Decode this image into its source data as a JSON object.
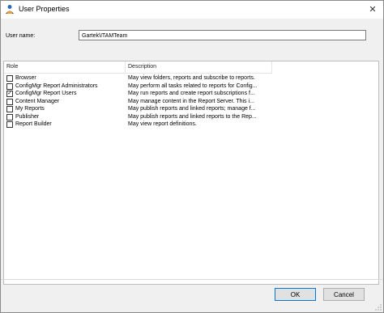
{
  "window": {
    "title": "User Properties"
  },
  "form": {
    "username_label": "User name:",
    "username_value": "Gartek\\ITAMTeam"
  },
  "grid": {
    "columns": [
      "Role",
      "Description"
    ],
    "rows": [
      {
        "role": "Browser",
        "description": "May view folders, reports and subscribe to reports.",
        "checked": false
      },
      {
        "role": "ConfigMgr Report Administrators",
        "description": "May perform all tasks related to reports for Config...",
        "checked": false
      },
      {
        "role": "ConfigMgr Report Users",
        "description": "May run reports and create report subscriptions f...",
        "checked": true
      },
      {
        "role": "Content Manager",
        "description": "May manage content in the Report Server.  This i...",
        "checked": false
      },
      {
        "role": "My Reports",
        "description": "May publish reports and linked reports; manage f...",
        "checked": false
      },
      {
        "role": "Publisher",
        "description": "May publish reports and linked reports to the Rep...",
        "checked": false
      },
      {
        "role": "Report Builder",
        "description": "May view report definitions.",
        "checked": false
      }
    ]
  },
  "buttons": {
    "ok": "OK",
    "cancel": "Cancel"
  },
  "icons": {
    "title": "user-properties-icon",
    "close": "close-icon",
    "checkbox": "checkbox-icon"
  }
}
